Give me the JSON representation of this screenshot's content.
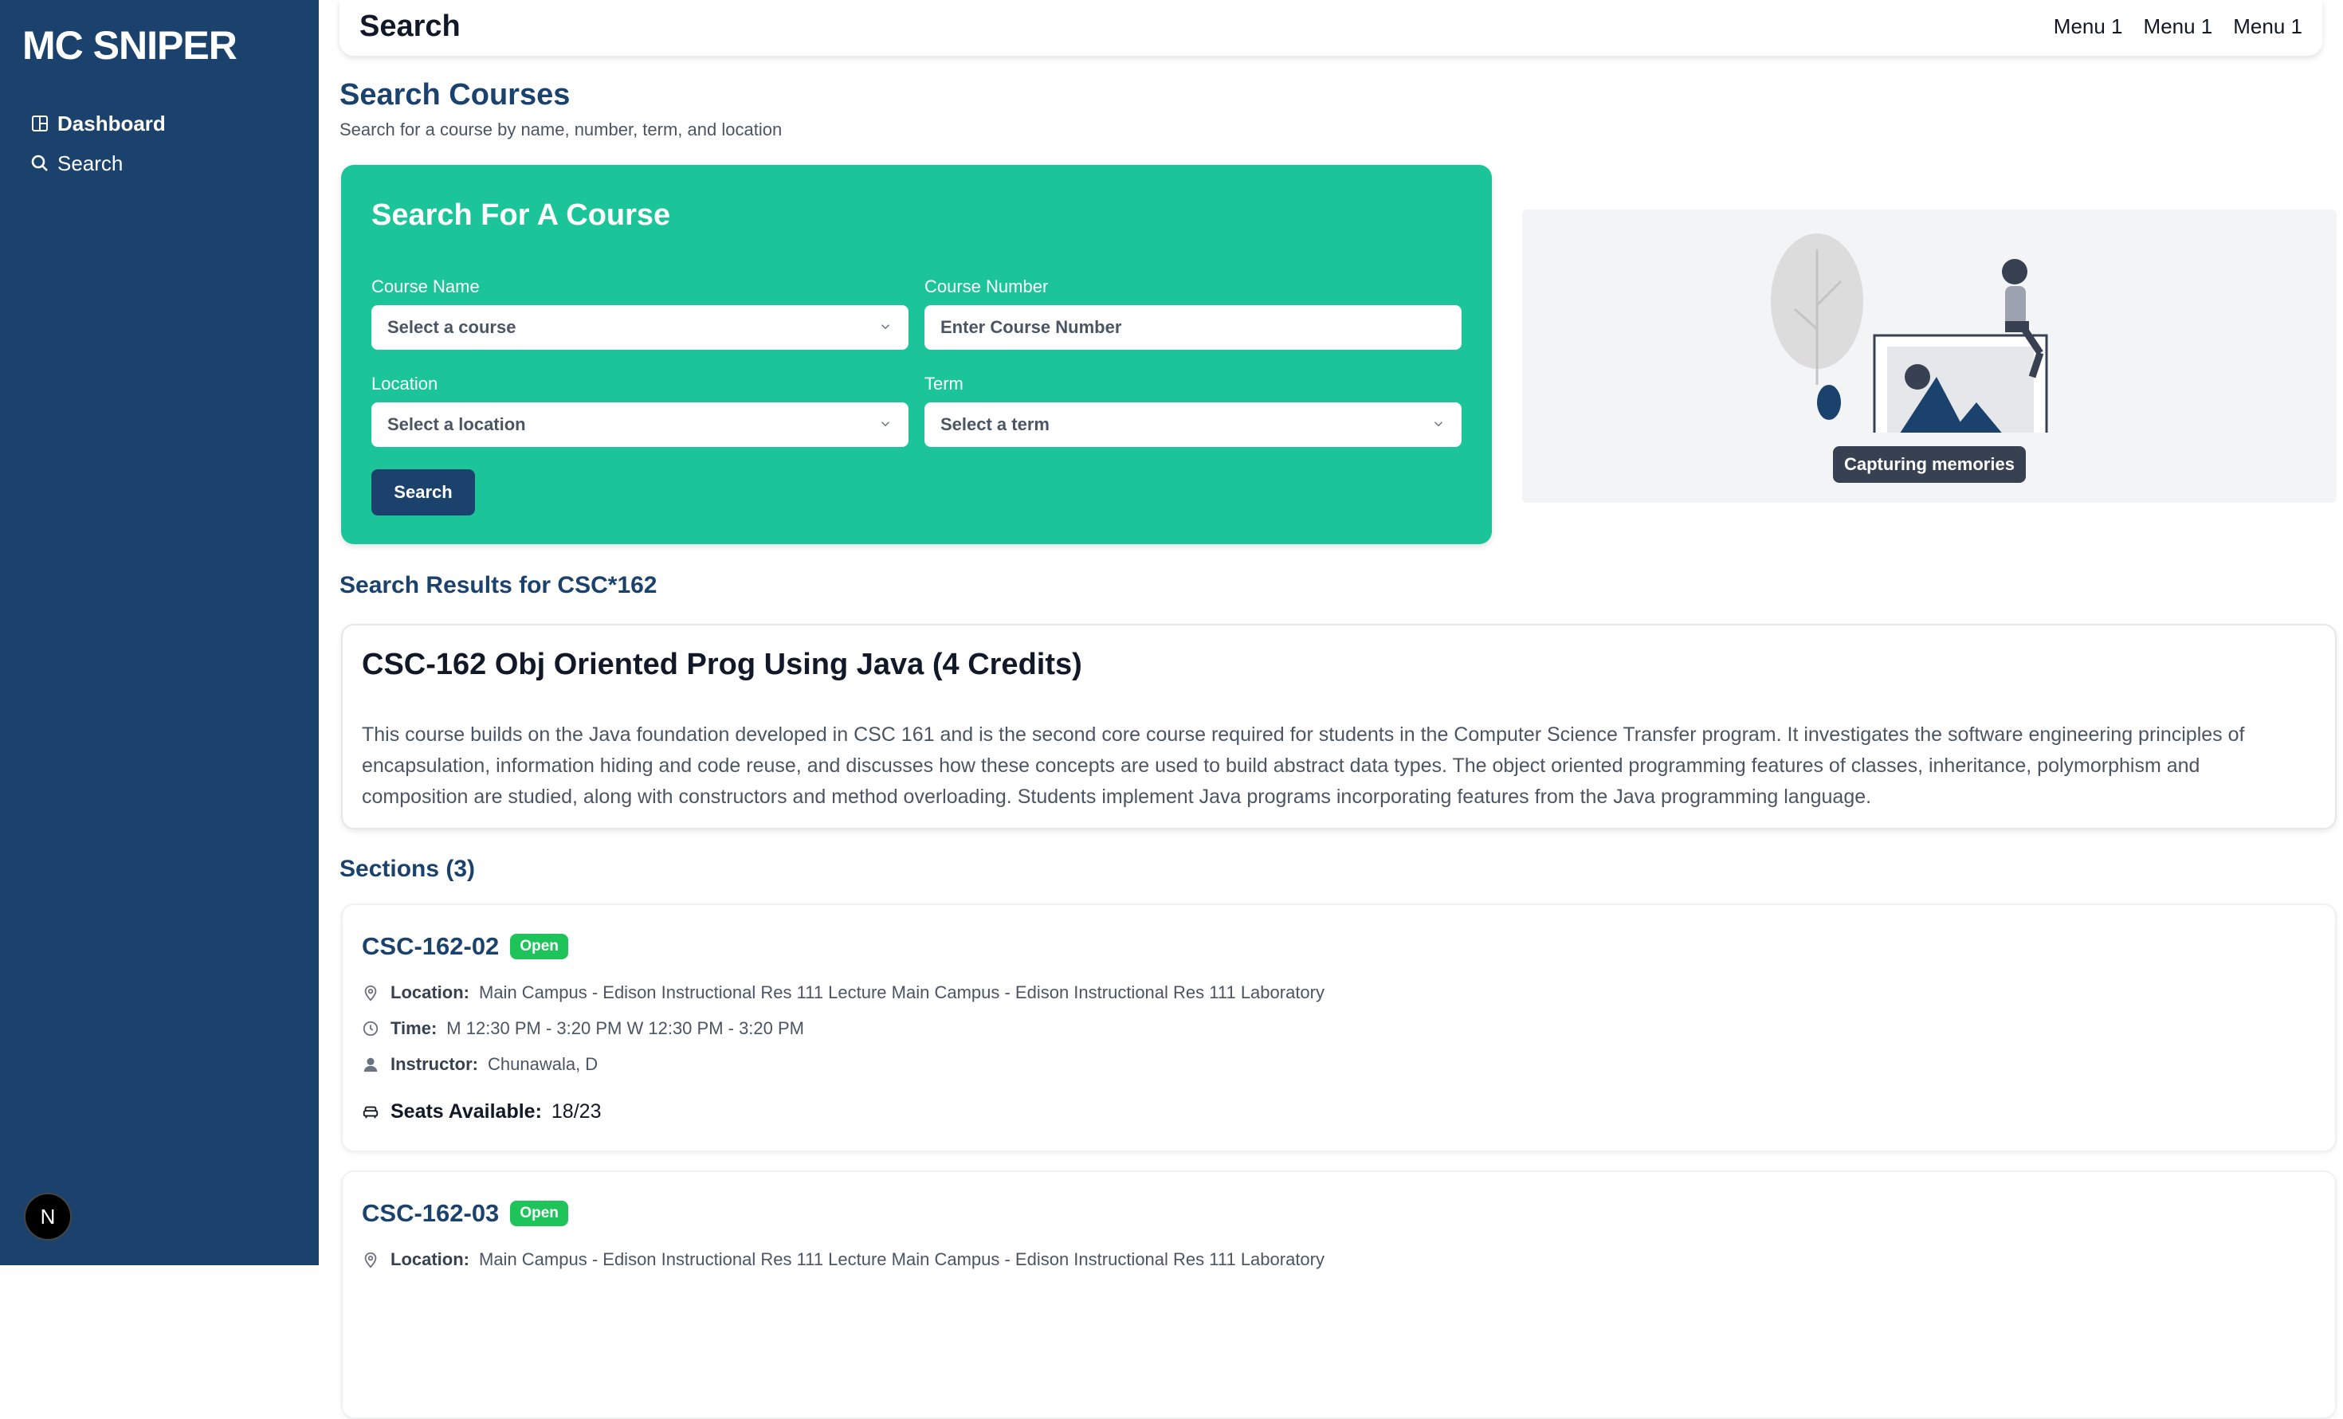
{
  "sidebar": {
    "brand": "MC SNIPER",
    "items": [
      {
        "label": "Dashboard",
        "icon": "dashboard-icon"
      },
      {
        "label": "Search",
        "icon": "search-icon"
      }
    ],
    "badge_letter": "N"
  },
  "topbar": {
    "title": "Search",
    "menus": [
      "Menu 1",
      "Menu 1",
      "Menu 1"
    ]
  },
  "page": {
    "title": "Search Courses",
    "subtitle": "Search for a course by name, number, term, and location"
  },
  "search_form": {
    "title": "Search For A Course",
    "course_name": {
      "label": "Course Name",
      "value": "Select a course"
    },
    "course_number": {
      "label": "Course Number",
      "placeholder": "Enter Course Number"
    },
    "location": {
      "label": "Location",
      "value": "Select a location"
    },
    "term": {
      "label": "Term",
      "value": "Select a term"
    },
    "button_label": "Search"
  },
  "illustration": {
    "caption": "Capturing memories"
  },
  "results": {
    "heading": "Search Results for CSC*162",
    "course_title": "CSC-162 Obj Oriented Prog Using Java (4 Credits)",
    "description": "This course builds on the Java foundation developed in CSC 161 and is the second core course required for students in the Computer Science Transfer program. It investigates the software engineering principles of encapsulation, information hiding and code reuse, and discusses how these concepts are used to build abstract data types. The object oriented programming features of classes, inheritance, polymorphism and composition are studied, along with constructors and method overloading. Students implement Java programs incorporating features from the Java programming language."
  },
  "sections": {
    "heading": "Sections (3)",
    "labels": {
      "location": "Location:",
      "time": "Time:",
      "instructor": "Instructor:",
      "seats": "Seats Available:"
    },
    "items": [
      {
        "code": "CSC-162-02",
        "status": "Open",
        "location": "Main Campus - Edison Instructional Res 111 Lecture Main Campus - Edison Instructional Res 111 Laboratory",
        "time": "M 12:30 PM - 3:20 PM W 12:30 PM - 3:20 PM",
        "instructor": "Chunawala, D",
        "seats": "18/23"
      },
      {
        "code": "CSC-162-03",
        "status": "Open",
        "location": "Main Campus - Edison Instructional Res 111 Lecture Main Campus - Edison Instructional Res 111 Laboratory"
      }
    ]
  },
  "colors": {
    "sidebar": "#1b426d",
    "accent": "#1bc599",
    "primary": "#1b426d",
    "open_badge": "#1ec45a"
  }
}
